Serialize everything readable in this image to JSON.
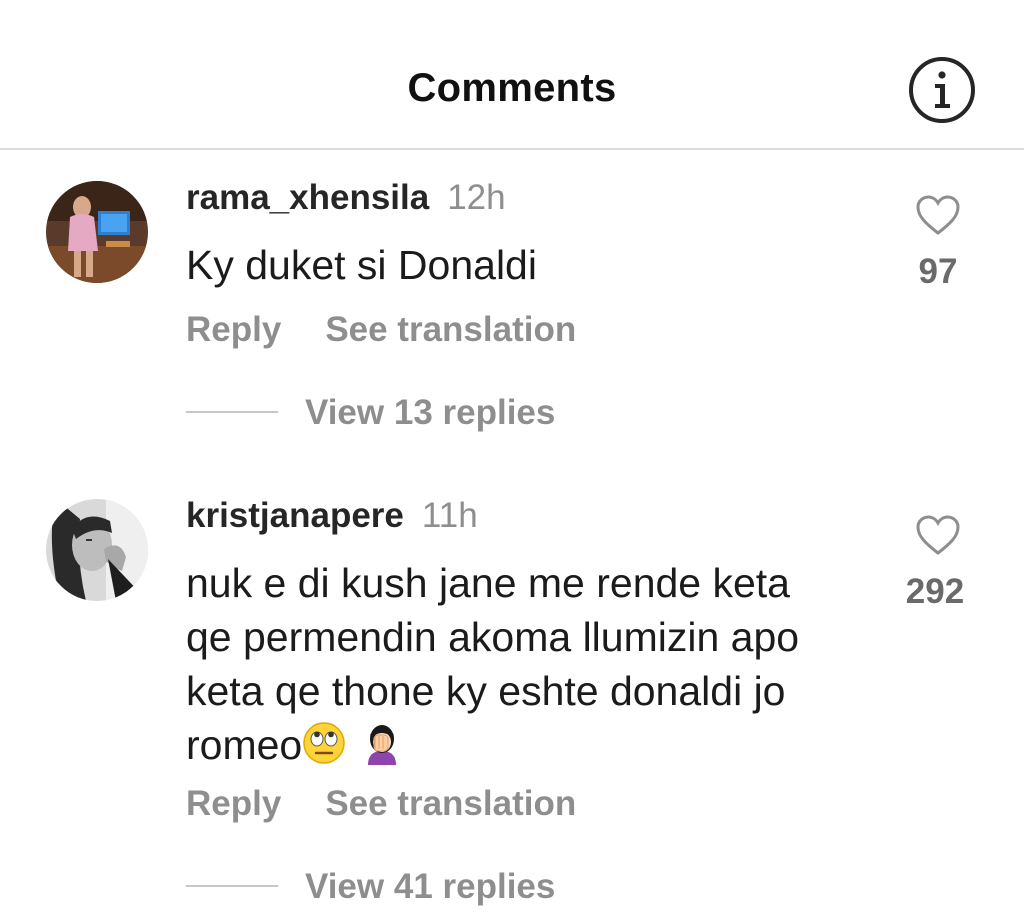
{
  "header": {
    "title": "Comments",
    "info_icon": "info-icon"
  },
  "comments": [
    {
      "username": "rama_xhensila",
      "time": "12h",
      "text": "Ky duket si Donaldi",
      "likes": "97",
      "reply_label": "Reply",
      "translate_label": "See translation",
      "replies_label": "View 13 replies"
    },
    {
      "username": "kristjanapere",
      "time": "11h",
      "text_lines": [
        "nuk e di kush jane me rende keta",
        "qe permendin akoma llumizin apo",
        "keta qe thone ky eshte donaldi jo",
        "romeo"
      ],
      "emojis": [
        "face-with-rolling-eyes-emoji",
        "woman-facepalming-emoji"
      ],
      "likes": "292",
      "reply_label": "Reply",
      "translate_label": "See translation",
      "replies_label": "View 41 replies"
    }
  ],
  "colors": {
    "primary_text": "#262626",
    "secondary_text": "#8e8e8e",
    "divider": "#dbdbdb"
  }
}
